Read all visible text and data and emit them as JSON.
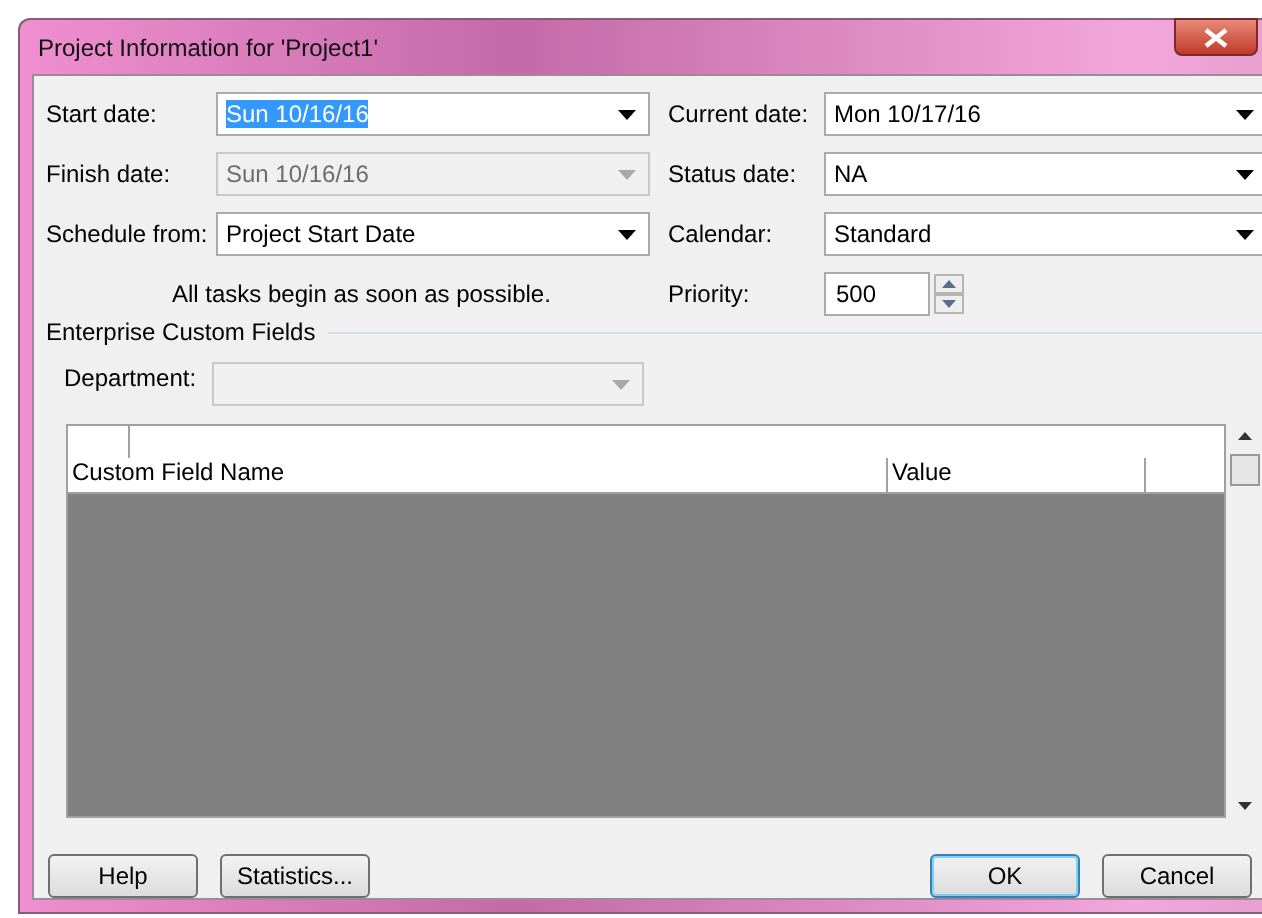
{
  "window": {
    "title": "Project Information for 'Project1'"
  },
  "left_fields": [
    {
      "label": "Start date:",
      "value": "Sun 10/16/16",
      "disabled": false,
      "selected": true
    },
    {
      "label": "Finish date:",
      "value": "Sun 10/16/16",
      "disabled": true,
      "selected": false
    },
    {
      "label": "Schedule from:",
      "value": "Project Start Date",
      "disabled": false,
      "selected": false
    }
  ],
  "note": "All tasks begin as soon as possible.",
  "right_fields": [
    {
      "kind": "dropdown",
      "label": "Current date:",
      "value": "Mon 10/17/16"
    },
    {
      "kind": "dropdown",
      "label": "Status date:",
      "value": "NA"
    },
    {
      "kind": "dropdown",
      "label": "Calendar:",
      "value": "Standard"
    },
    {
      "kind": "spinner",
      "label": "Priority:",
      "value": "500"
    }
  ],
  "enterprise": {
    "title": "Enterprise Custom Fields",
    "department_label": "Department:",
    "department_disabled": true
  },
  "table": {
    "columns": [
      "Custom Field Name",
      "Value"
    ]
  },
  "buttons": [
    {
      "label": "Help",
      "default": false
    },
    {
      "label": "Statistics...",
      "default": false
    },
    {
      "label": "OK",
      "default": true
    },
    {
      "label": "Cancel",
      "default": false
    }
  ]
}
